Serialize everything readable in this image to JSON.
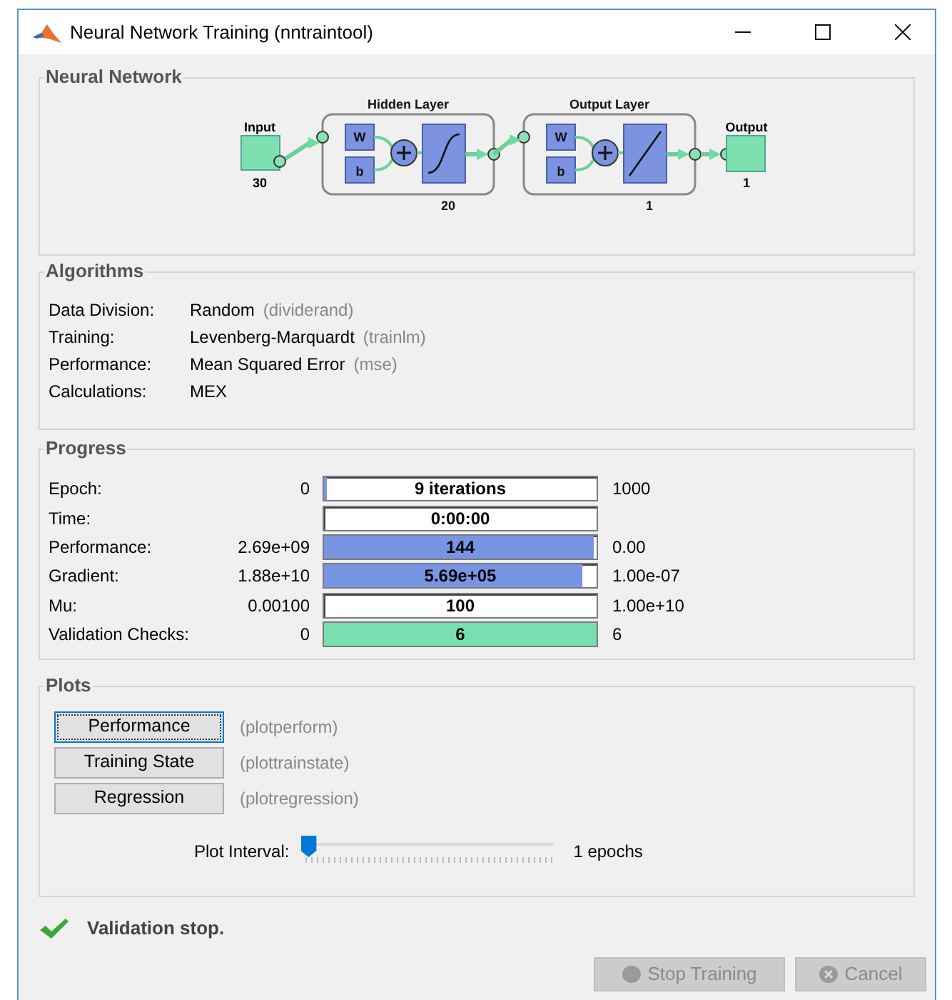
{
  "window": {
    "title": "Neural Network Training (nntraintool)"
  },
  "network": {
    "title": "Neural Network",
    "input": {
      "label": "Input",
      "size": "30"
    },
    "output": {
      "label": "Output",
      "size": "1"
    },
    "layers": [
      {
        "title": "Hidden Layer",
        "weight": "W",
        "bias": "b",
        "kind": "sigmoid",
        "size": "20"
      },
      {
        "title": "Output Layer",
        "weight": "W",
        "bias": "b",
        "kind": "linear",
        "size": "1"
      }
    ]
  },
  "algorithms": {
    "title": "Algorithms",
    "rows": [
      {
        "label": "Data Division:",
        "value": "Random",
        "function": "(dividerand)"
      },
      {
        "label": "Training:",
        "value": "Levenberg-Marquardt",
        "function": "(trainlm)"
      },
      {
        "label": "Performance:",
        "value": "Mean Squared Error",
        "function": "(mse)"
      },
      {
        "label": "Calculations:",
        "value": "MEX"
      }
    ]
  },
  "progress": {
    "title": "Progress",
    "rows": [
      {
        "label": "Epoch:",
        "start": "0",
        "reading": "9 iterations",
        "level": 0.01,
        "kind": "blue",
        "end": "1000"
      },
      {
        "label": "Time:",
        "reading": "0:00:00",
        "level": 0,
        "kind": "blue"
      },
      {
        "label": "Performance:",
        "start": "2.69e+09",
        "reading": "144",
        "level": 0.99,
        "kind": "blue",
        "end": "0.00"
      },
      {
        "label": "Gradient:",
        "start": "1.88e+10",
        "reading": "5.69e+05",
        "level": 0.95,
        "kind": "blue",
        "end": "1.00e-07"
      },
      {
        "label": "Mu:",
        "start": "0.00100",
        "reading": "100",
        "level": 0,
        "kind": "blue",
        "end": "1.00e+10"
      },
      {
        "label": "Validation Checks:",
        "start": "0",
        "reading": "6",
        "level": 1,
        "kind": "green",
        "end": "6"
      }
    ]
  },
  "plots": {
    "title": "Plots",
    "buttons": [
      {
        "label": "Performance",
        "function": "(plotperform)",
        "focused": true
      },
      {
        "label": "Training State",
        "function": "(plottrainstate)",
        "focused": false
      },
      {
        "label": "Regression",
        "function": "(plotregression)",
        "focused": false
      }
    ],
    "interval": {
      "label": "Plot Interval:",
      "level": 0,
      "reading": "1 epochs"
    }
  },
  "status": "Validation stop.",
  "buttons": [
    {
      "label": "Stop Training",
      "kind": "stop",
      "disabled": true
    },
    {
      "label": "Cancel",
      "kind": "cancel",
      "disabled": true
    }
  ]
}
